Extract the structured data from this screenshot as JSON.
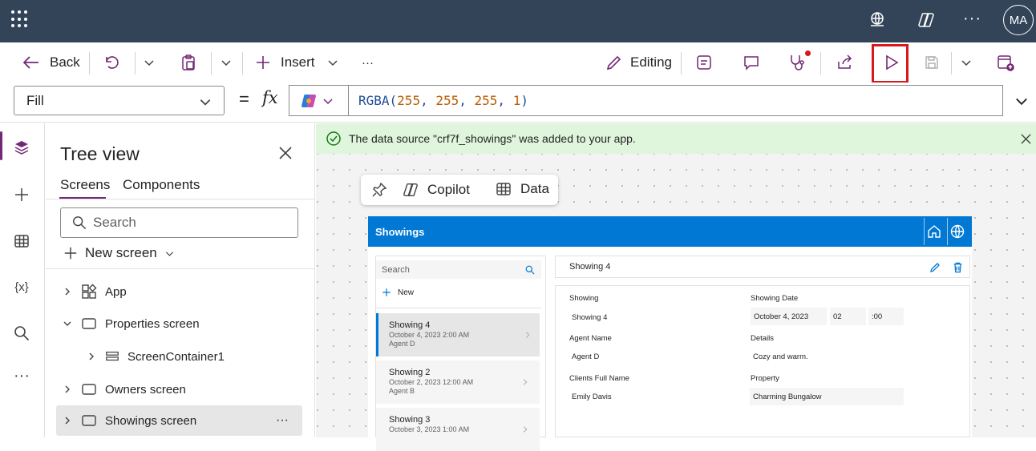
{
  "topbar": {
    "avatar_initials": "MA",
    "icons": [
      "waffle-icon",
      "environment-icon",
      "copilot-icon",
      "more-icon"
    ]
  },
  "commandbar": {
    "back_label": "Back",
    "insert_label": "Insert",
    "more_label": "···",
    "editing_label": "Editing"
  },
  "formula": {
    "property": "Fill",
    "equals": "=",
    "fx": "fx",
    "expression_fn": "RGBA(",
    "expression_args": [
      "255",
      "255",
      "255",
      "1"
    ],
    "expression_close": ")"
  },
  "banner": {
    "message": "The data source \"crf7f_showings\" was added to your app."
  },
  "tree": {
    "title": "Tree view",
    "tabs": [
      "Screens",
      "Components"
    ],
    "search_placeholder": "Search",
    "new_screen_label": "New screen",
    "items": [
      {
        "label": "App"
      },
      {
        "label": "Properties screen"
      },
      {
        "label": "ScreenContainer1"
      },
      {
        "label": "Owners screen"
      },
      {
        "label": "Showings screen",
        "more": "···"
      }
    ]
  },
  "floatbar": {
    "copilot_label": "Copilot",
    "data_label": "Data"
  },
  "app": {
    "header_title": "Showings",
    "search_placeholder": "Search",
    "new_label": "New",
    "cards": [
      {
        "title": "Showing 4",
        "date": "October 4, 2023 2:00 AM",
        "agent": "Agent D"
      },
      {
        "title": "Showing 2",
        "date": "October 2, 2023 12:00 AM",
        "agent": "Agent B"
      },
      {
        "title": "Showing 3",
        "date": "October 3, 2023 1:00 AM",
        "agent": ""
      }
    ],
    "detail": {
      "title": "Showing 4",
      "fields": {
        "showing_label": "Showing",
        "showing_value": "Showing 4",
        "date_label": "Showing Date",
        "date_value": "October 4, 2023",
        "hour_value": "02",
        "minute_value": "00",
        "agent_label": "Agent Name",
        "agent_value": "Agent D",
        "details_label": "Details",
        "details_value": "Cozy and warm.",
        "client_label": "Clients Full Name",
        "client_value": "Emily Davis",
        "property_label": "Property",
        "property_value": "Charming Bungalow"
      }
    }
  },
  "colors": {
    "topbar": "#334459",
    "accent": "#742774",
    "app_header": "#0078d4",
    "banner": "#dff6dd",
    "highlight": "#d7191c"
  }
}
